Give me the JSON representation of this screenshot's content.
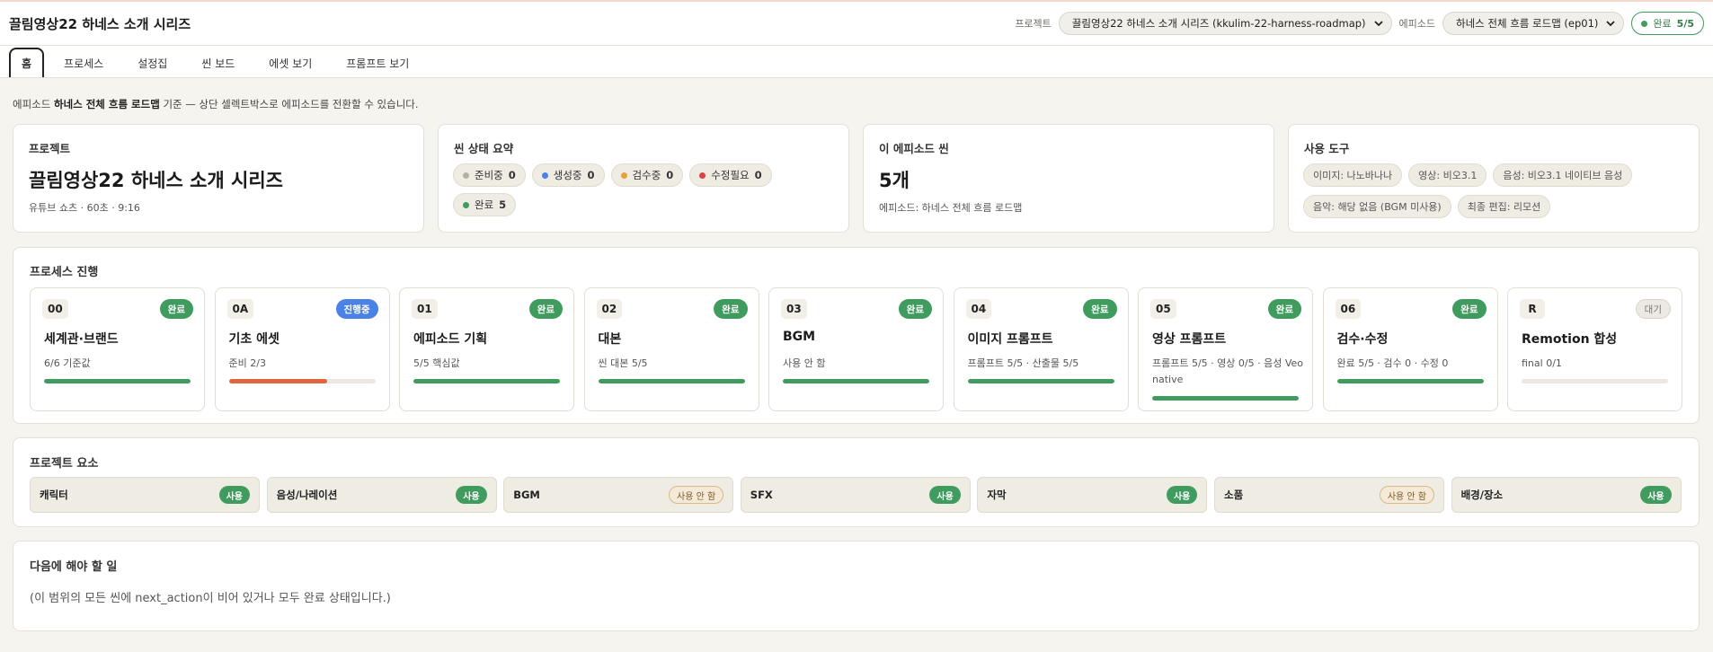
{
  "header": {
    "title": "끌림영상22 하네스 소개 시리즈",
    "project_label": "프로젝트",
    "project_value": "끌림영상22 하네스 소개 시리즈 (kkulim-22-harness-roadmap)",
    "episode_label": "에피소드",
    "episode_value": "하네스 전체 흐름 로드맵 (ep01)",
    "status_text": "완료",
    "status_count": "5/5"
  },
  "tabs": [
    {
      "label": "홈"
    },
    {
      "label": "프로세스"
    },
    {
      "label": "설정집"
    },
    {
      "label": "씬 보드"
    },
    {
      "label": "에셋 보기"
    },
    {
      "label": "프롬프트 보기"
    }
  ],
  "note": {
    "prefix": "에피소드 ",
    "bold": "하네스 전체 흐름 로드맵",
    "suffix": " 기준 — 상단 셀렉트박스로 에피소드를 전환할 수 있습니다."
  },
  "summary": {
    "project": {
      "title": "프로젝트",
      "name": "끌림영상22 하네스 소개 시리즈",
      "meta": "유튜브 쇼츠 · 60초 · 9:16"
    },
    "scene_status": {
      "title": "씬 상태 요약",
      "items": [
        {
          "label": "준비중",
          "count": "0",
          "color": "#b5b0a6"
        },
        {
          "label": "생성중",
          "count": "0",
          "color": "#4b82e6"
        },
        {
          "label": "검수중",
          "count": "0",
          "color": "#e5a03b"
        },
        {
          "label": "수정필요",
          "count": "0",
          "color": "#d94444"
        },
        {
          "label": "완료",
          "count": "5",
          "color": "#3f9b5e"
        }
      ]
    },
    "episode_scenes": {
      "title": "이 에피소드 씬",
      "count": "5개",
      "meta": "에피소드: 하네스 전체 흐름 로드맵"
    },
    "tools": {
      "title": "사용 도구",
      "items": [
        "이미지: 나노바나나",
        "영상: 비오3.1",
        "음성: 비오3.1 네이티브 음성",
        "음악: 해당 없음 (BGM 미사용)",
        "최종 편집: 리모션"
      ]
    }
  },
  "process": {
    "title": "프로세스 진행",
    "steps": [
      {
        "code": "00",
        "badge": "완료",
        "state": "done",
        "name": "세계관·브랜드",
        "detail": "6/6 기준값",
        "progress": 1.0,
        "bar_color": "#3f9b5e"
      },
      {
        "code": "0A",
        "badge": "진행중",
        "state": "prog",
        "name": "기초 에셋",
        "detail": "준비 2/3",
        "progress": 0.67,
        "bar_color": "#e0663f"
      },
      {
        "code": "01",
        "badge": "완료",
        "state": "done",
        "name": "에피소드 기획",
        "detail": "5/5 핵심값",
        "progress": 1.0,
        "bar_color": "#3f9b5e"
      },
      {
        "code": "02",
        "badge": "완료",
        "state": "done",
        "name": "대본",
        "detail": "씬 대본 5/5",
        "progress": 1.0,
        "bar_color": "#3f9b5e"
      },
      {
        "code": "03",
        "badge": "완료",
        "state": "done",
        "name": "BGM",
        "detail": "사용 안 함",
        "progress": 1.0,
        "bar_color": "#3f9b5e"
      },
      {
        "code": "04",
        "badge": "완료",
        "state": "done",
        "name": "이미지 프롬프트",
        "detail": "프롬프트 5/5 · 산출물 5/5",
        "progress": 1.0,
        "bar_color": "#3f9b5e"
      },
      {
        "code": "05",
        "badge": "완료",
        "state": "done",
        "name": "영상 프롬프트",
        "detail": "프롬프트 5/5 · 영상 0/5 · 음성 Veo native",
        "progress": 1.0,
        "bar_color": "#3f9b5e"
      },
      {
        "code": "06",
        "badge": "완료",
        "state": "done",
        "name": "검수·수정",
        "detail": "완료 5/5 · 검수 0 · 수정 0",
        "progress": 1.0,
        "bar_color": "#3f9b5e"
      },
      {
        "code": "R",
        "badge": "대기",
        "state": "wait",
        "name": "Remotion 합성",
        "detail": "final 0/1",
        "progress": 0.0,
        "bar_color": "#3f9b5e"
      }
    ]
  },
  "elements": {
    "title": "프로젝트 요소",
    "items": [
      {
        "name": "캐릭터",
        "badge": "사용",
        "used": true
      },
      {
        "name": "음성/나레이션",
        "badge": "사용",
        "used": true
      },
      {
        "name": "BGM",
        "badge": "사용 안 함",
        "used": false
      },
      {
        "name": "SFX",
        "badge": "사용",
        "used": true
      },
      {
        "name": "자막",
        "badge": "사용",
        "used": true
      },
      {
        "name": "소품",
        "badge": "사용 안 함",
        "used": false
      },
      {
        "name": "배경/장소",
        "badge": "사용",
        "used": true
      }
    ]
  },
  "next": {
    "title": "다음에 해야 할 일",
    "text": "(이 범위의 모든 씬에 next_action이 비어 있거나 모두 완료 상태입니다.)"
  }
}
